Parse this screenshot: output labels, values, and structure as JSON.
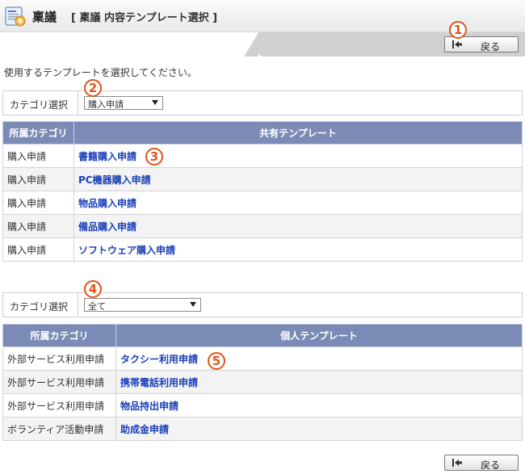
{
  "header": {
    "title": "稟議",
    "subtitle": "[ 稟議 内容テンプレート選択 ]",
    "app_icon": "form-icon"
  },
  "back_button": {
    "label": "戻る",
    "icon": "arrow-left-icon"
  },
  "instruction": "使用するテンプレートを選択してください。",
  "shared": {
    "category_label": "カテゴリ選択",
    "category_value": "購入申請",
    "columns": [
      "所属カテゴリ",
      "共有テンプレート"
    ],
    "rows": [
      {
        "category": "購入申請",
        "template": "書籍購入申請"
      },
      {
        "category": "購入申請",
        "template": "PC機器購入申請"
      },
      {
        "category": "購入申請",
        "template": "物品購入申請"
      },
      {
        "category": "購入申請",
        "template": "備品購入申請"
      },
      {
        "category": "購入申請",
        "template": "ソフトウェア購入申請"
      }
    ]
  },
  "personal": {
    "category_label": "カテゴリ選択",
    "category_value": "全て",
    "columns": [
      "所属カテゴリ",
      "個人テンプレート"
    ],
    "rows": [
      {
        "category": "外部サービス利用申請",
        "template": "タクシー利用申請"
      },
      {
        "category": "外部サービス利用申請",
        "template": "携帯電話利用申請"
      },
      {
        "category": "外部サービス利用申請",
        "template": "物品持出申請"
      },
      {
        "category": "ボランティア活動申請",
        "template": "助成金申請"
      }
    ]
  },
  "callouts": [
    "1",
    "2",
    "3",
    "4",
    "5"
  ],
  "colors": {
    "header_row": "#7b8bb6",
    "link": "#1a3fb8",
    "callout": "#e2531a"
  }
}
